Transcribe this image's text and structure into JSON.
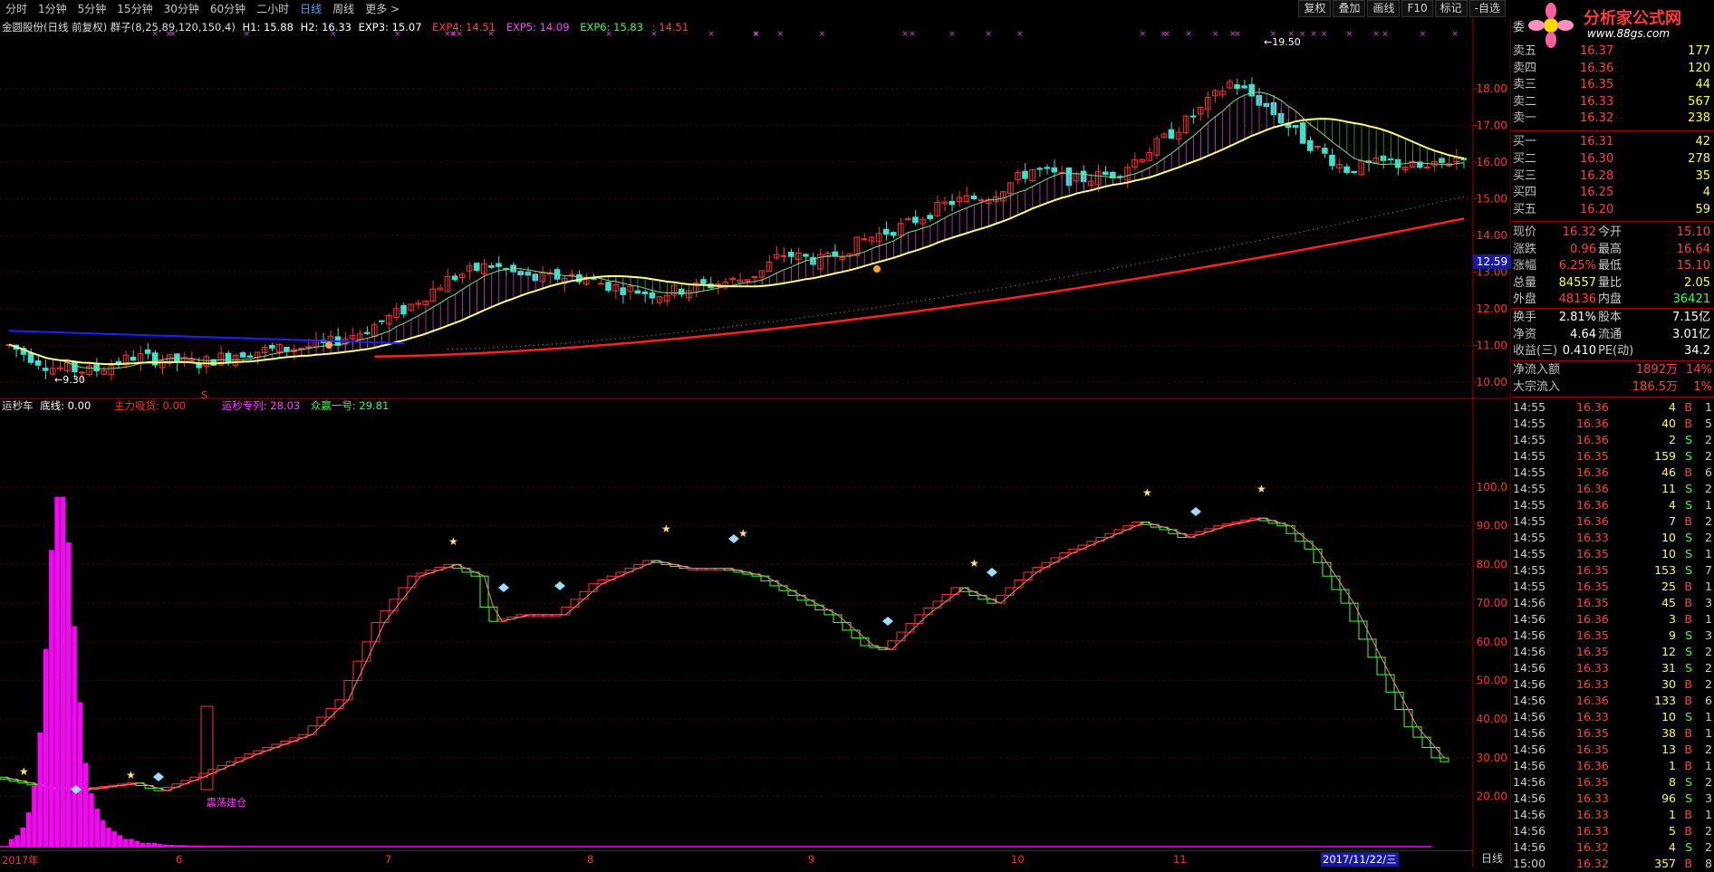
{
  "toolbar": {
    "periods": [
      "分时",
      "1分钟",
      "5分钟",
      "15分钟",
      "30分钟",
      "60分钟",
      "二小时",
      "日线",
      "周线",
      "更多 >"
    ],
    "active_period": "日线",
    "buttons": [
      "复权",
      "叠加",
      "画线",
      "F10",
      "标记",
      "-自选"
    ]
  },
  "logo": {
    "text": "分析家公式网",
    "url": "www.88gs.com"
  },
  "main_info": {
    "name": "金圆股份(日线 前复权) 群子(8,25,89,120,150,4)",
    "h1": "H1: 15.88",
    "h2": "H2: 16.33",
    "exp3": "EXP3: 15.07",
    "exp4": "EXP4: 14.51",
    "exp5": "EXP5: 14.09",
    "exp6": "EXP6: 15.83",
    "extra": ": 14.51"
  },
  "annotations": {
    "high": "19.50",
    "low": "9.30",
    "s_mark": "S",
    "build": "震荡建仓"
  },
  "price_axis": [
    "18.00",
    "17.00",
    "16.00",
    "15.00",
    "14.00",
    "13.00",
    "12.00",
    "11.00",
    "10.00"
  ],
  "current_price_badge": "12.59",
  "sub_info": {
    "name": "运秒车",
    "bottom": "底线: 0.00",
    "main_absorb": "主力吸货: 0.00",
    "series1": "运秒专列: 28.03",
    "series2": "众赢一号: 29.81"
  },
  "sub_axis": [
    "100.0",
    "90.00",
    "80.00",
    "70.00",
    "60.00",
    "50.00",
    "40.00",
    "30.00",
    "20.00"
  ],
  "dates": [
    "2017年",
    "6",
    "7",
    "8",
    "9",
    "10",
    "11",
    "2"
  ],
  "date_highlight": "2017/11/22/三",
  "right_day_label": "日线",
  "order_book": {
    "header": "委",
    "sells": [
      {
        "label": "卖五",
        "price": "16.37",
        "vol": "177"
      },
      {
        "label": "卖四",
        "price": "16.36",
        "vol": "120"
      },
      {
        "label": "卖三",
        "price": "16.35",
        "vol": "44"
      },
      {
        "label": "卖二",
        "price": "16.33",
        "vol": "567"
      },
      {
        "label": "卖一",
        "price": "16.32",
        "vol": "238"
      }
    ],
    "buys": [
      {
        "label": "买一",
        "price": "16.31",
        "vol": "42"
      },
      {
        "label": "买二",
        "price": "16.30",
        "vol": "278"
      },
      {
        "label": "买三",
        "price": "16.28",
        "vol": "35"
      },
      {
        "label": "买四",
        "price": "16.25",
        "vol": "4"
      },
      {
        "label": "买五",
        "price": "16.20",
        "vol": "59"
      }
    ]
  },
  "quote": [
    {
      "l1": "现价",
      "v1": "16.32",
      "l2": "今开",
      "v2": "15.10"
    },
    {
      "l1": "涨跌",
      "v1": "0.96",
      "l2": "最高",
      "v2": "16.64"
    },
    {
      "l1": "涨幅",
      "v1": "6.25%",
      "l2": "最低",
      "v2": "15.10"
    },
    {
      "l1": "总量",
      "v1": "84557",
      "l2": "量比",
      "v2": "2.05"
    },
    {
      "l1": "外盘",
      "v1": "48136",
      "l2": "内盘",
      "v2": "36421"
    }
  ],
  "quote2": [
    {
      "l1": "换手",
      "v1": "2.81%",
      "l2": "股本",
      "v2": "7.15亿"
    },
    {
      "l1": "净资",
      "v1": "4.64",
      "l2": "流通",
      "v2": "3.01亿"
    },
    {
      "l1": "收益(三)",
      "v1": "0.410",
      "l2": "PE(动)",
      "v2": "34.2"
    }
  ],
  "flows": [
    {
      "label": "净流入额",
      "value": "1892万",
      "pct": "14%"
    },
    {
      "label": "大宗流入",
      "value": "186.5万",
      "pct": "1%"
    }
  ],
  "ticks": [
    {
      "t": "14:55",
      "p": "16.36",
      "v": "4",
      "s": "B",
      "n": "1"
    },
    {
      "t": "14:55",
      "p": "16.36",
      "v": "40",
      "s": "B",
      "n": "5"
    },
    {
      "t": "14:55",
      "p": "16.36",
      "v": "2",
      "s": "S",
      "n": "2"
    },
    {
      "t": "14:55",
      "p": "16.35",
      "v": "159",
      "s": "S",
      "n": "2"
    },
    {
      "t": "14:55",
      "p": "16.36",
      "v": "46",
      "s": "B",
      "n": "6"
    },
    {
      "t": "14:55",
      "p": "16.36",
      "v": "11",
      "s": "S",
      "n": "2"
    },
    {
      "t": "14:55",
      "p": "16.36",
      "v": "4",
      "s": "S",
      "n": "1"
    },
    {
      "t": "14:55",
      "p": "16.36",
      "v": "7",
      "s": "B",
      "n": "2"
    },
    {
      "t": "14:55",
      "p": "16.33",
      "v": "10",
      "s": "S",
      "n": "2"
    },
    {
      "t": "14:55",
      "p": "16.35",
      "v": "10",
      "s": "S",
      "n": "1"
    },
    {
      "t": "14:55",
      "p": "16.35",
      "v": "153",
      "s": "S",
      "n": "7"
    },
    {
      "t": "14:55",
      "p": "16.35",
      "v": "25",
      "s": "B",
      "n": "1"
    },
    {
      "t": "14:56",
      "p": "16.35",
      "v": "45",
      "s": "B",
      "n": "3"
    },
    {
      "t": "14:56",
      "p": "16.36",
      "v": "3",
      "s": "B",
      "n": "1"
    },
    {
      "t": "14:56",
      "p": "16.35",
      "v": "9",
      "s": "S",
      "n": "3"
    },
    {
      "t": "14:56",
      "p": "16.35",
      "v": "12",
      "s": "S",
      "n": "2"
    },
    {
      "t": "14:56",
      "p": "16.33",
      "v": "31",
      "s": "S",
      "n": "2"
    },
    {
      "t": "14:56",
      "p": "16.33",
      "v": "30",
      "s": "B",
      "n": "2"
    },
    {
      "t": "14:56",
      "p": "16.36",
      "v": "133",
      "s": "B",
      "n": "6"
    },
    {
      "t": "14:56",
      "p": "16.33",
      "v": "10",
      "s": "S",
      "n": "1"
    },
    {
      "t": "14:56",
      "p": "16.35",
      "v": "38",
      "s": "B",
      "n": "1"
    },
    {
      "t": "14:56",
      "p": "16.35",
      "v": "13",
      "s": "B",
      "n": "2"
    },
    {
      "t": "14:56",
      "p": "16.36",
      "v": "1",
      "s": "B",
      "n": "1"
    },
    {
      "t": "14:56",
      "p": "16.35",
      "v": "8",
      "s": "S",
      "n": "2"
    },
    {
      "t": "14:56",
      "p": "16.33",
      "v": "96",
      "s": "S",
      "n": "3"
    },
    {
      "t": "14:56",
      "p": "16.33",
      "v": "1",
      "s": "B",
      "n": "1"
    },
    {
      "t": "14:56",
      "p": "16.33",
      "v": "5",
      "s": "B",
      "n": "2"
    },
    {
      "t": "14:56",
      "p": "16.32",
      "v": "4",
      "s": "S",
      "n": "2"
    },
    {
      "t": "15:00",
      "p": "16.32",
      "v": "357",
      "s": "B",
      "n": "8"
    }
  ],
  "colors": {
    "up": "#ff3030",
    "down": "#40e0d0",
    "ma_yellow": "#ffff80",
    "ma_red": "#ff2020",
    "ma_blue": "#2020ff",
    "magenta": "#ff00ff",
    "green": "#40ff40"
  }
}
